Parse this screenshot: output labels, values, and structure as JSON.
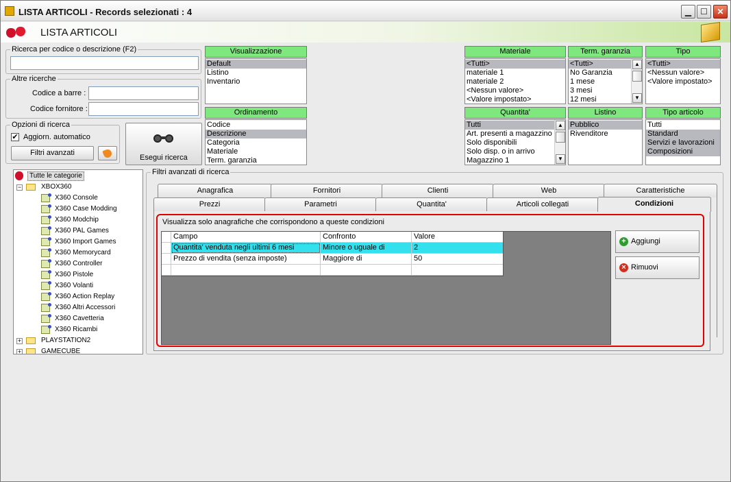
{
  "window": {
    "title": "LISTA ARTICOLI - Records selezionati : 4",
    "header_title": "LISTA ARTICOLI",
    "minimize_glyph": "▁",
    "maximize_glyph": "☐",
    "close_glyph": "✕"
  },
  "search": {
    "group_label": "Ricerca per codice o descrizione (F2)",
    "value": "",
    "other_group_label": "Altre ricerche",
    "barcode_label": "Codice a barre :",
    "barcode_value": "",
    "supplier_code_label": "Codice fornitore :",
    "supplier_code_value": "",
    "options_group_label": "Opzioni di ricerca",
    "auto_update_label": "Aggiorn. automatico",
    "auto_update_checked": true,
    "advanced_filters_button": "Filtri avanzati",
    "execute_button": "Esegui ricerca"
  },
  "lists": {
    "visualizzazione": {
      "header": "Visualizzazione",
      "items": [
        "Default",
        "Listino",
        "Inventario"
      ],
      "selected": 0
    },
    "ordinamento": {
      "header": "Ordinamento",
      "items": [
        "Codice",
        "Descrizione",
        "Categoria",
        "Materiale",
        "Term. garanzia"
      ],
      "selected": 1
    },
    "materiale": {
      "header": "Materiale",
      "items": [
        "<Tutti>",
        "materiale 1",
        "materiale 2",
        "<Nessun valore>",
        "<Valore impostato>"
      ],
      "selected": 0
    },
    "garanzia": {
      "header": "Term. garanzia",
      "items": [
        "<Tutti>",
        "No Garanzia",
        "1 mese",
        "3 mesi",
        "12 mesi"
      ],
      "selected": 0
    },
    "tipo": {
      "header": "Tipo",
      "items": [
        "<Tutti>",
        "<Nessun valore>",
        "<Valore impostato>"
      ],
      "selected": 0
    },
    "quantita": {
      "header": "Quantita'",
      "items": [
        "Tutti",
        "Art. presenti a magazzino",
        "Solo disponibili",
        "Solo disp. o in arrivo",
        "Magazzino 1"
      ],
      "selected": 0
    },
    "listino": {
      "header": "Listino",
      "items": [
        "Pubblico",
        "Rivenditore"
      ],
      "selected": 0
    },
    "tipo_articolo": {
      "header": "Tipo articolo",
      "items": [
        "Tutti",
        "Standard",
        "Servizi e lavorazioni",
        "Composizioni"
      ],
      "selected_multi": [
        1,
        2,
        3
      ]
    }
  },
  "tree": {
    "root": "Tutte le categorie",
    "xbox": "XBOX360",
    "children": [
      "X360 Console",
      "X360 Case Modding",
      "X360 Modchip",
      "X360 PAL Games",
      "X360 Import Games",
      "X360 Memorycard",
      "X360 Controller",
      "X360 Pistole",
      "X360 Volanti",
      "X360 Action Replay",
      "X360 Altri Accessori",
      "X360 Cavetteria",
      "X360 Ricambi"
    ],
    "ps2": "PLAYSTATION2",
    "gamecube": "GAMECUBE"
  },
  "advanced": {
    "group_label": "Filtri avanzati di ricerca",
    "tabs_top": [
      "Anagrafica",
      "Fornitori",
      "Clienti",
      "Web",
      "Caratteristiche"
    ],
    "tabs_bottom": [
      "Prezzi",
      "Parametri",
      "Quantita'",
      "Articoli collegati",
      "Condizioni"
    ],
    "active_tab": "Condizioni",
    "caption": "Visualizza solo anagrafiche che corrispondono a queste condizioni",
    "columns": [
      "Campo",
      "Confronto",
      "Valore"
    ],
    "rows": [
      [
        "Quantita' venduta negli ultimi 6 mesi",
        "Minore o uguale di",
        "2"
      ],
      [
        "Prezzo di vendita (senza imposte)",
        "Maggiore di",
        "50"
      ],
      [
        "",
        "",
        ""
      ]
    ],
    "add_button": "Aggiungi",
    "remove_button": "Rimuovi"
  }
}
